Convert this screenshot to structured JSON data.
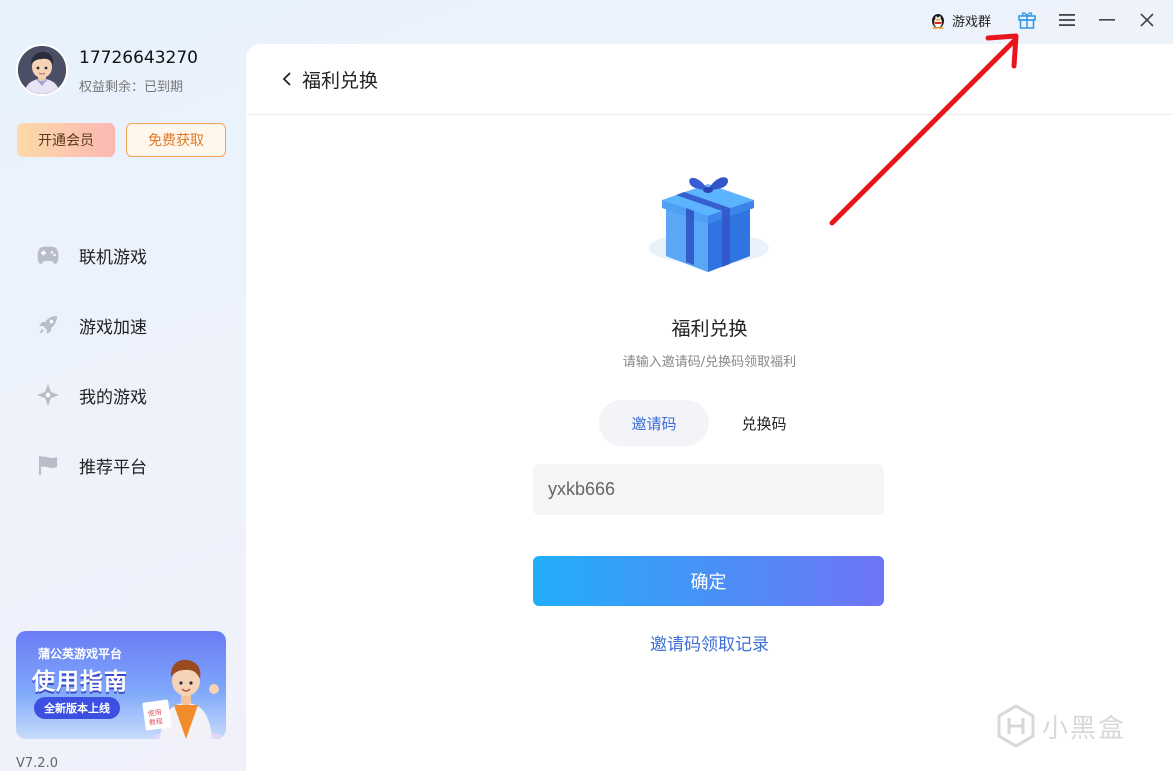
{
  "topbar": {
    "qq_group_label": "游戏群",
    "qq_icon": "qq-penguin-icon",
    "gift_icon": "gift-icon",
    "menu_icon": "menu-icon",
    "minimize_icon": "minimize-icon",
    "close_icon": "close-icon"
  },
  "user": {
    "phone": "17726643270",
    "rights_label": "权益剩余：",
    "rights_value": "已到期"
  },
  "sidebar": {
    "vip_button": "开通会员",
    "free_button": "免费获取",
    "items": [
      {
        "label": "联机游戏",
        "icon": "gamepad-icon"
      },
      {
        "label": "游戏加速",
        "icon": "rocket-icon"
      },
      {
        "label": "我的游戏",
        "icon": "star-diamond-icon"
      },
      {
        "label": "推荐平台",
        "icon": "flag-icon"
      }
    ],
    "banner": {
      "platform": "蒲公英游戏平台",
      "title": "使用指南",
      "pill": "全新版本上线"
    },
    "version": "V7.2.0"
  },
  "main": {
    "header_title": "福利兑换",
    "card_title": "福利兑换",
    "card_subtitle": "请输入邀请码/兑换码领取福利",
    "tabs": [
      {
        "label": "邀请码",
        "active": true
      },
      {
        "label": "兑换码",
        "active": false
      }
    ],
    "code_value": "yxkb666",
    "confirm_label": "确定",
    "record_link": "邀请码领取记录"
  },
  "watermark": {
    "text": "小黑盒"
  },
  "colors": {
    "accent_blue": "#3c6bd8",
    "confirm_gradient_start": "#22aef8",
    "confirm_gradient_end": "#6f74f5",
    "vip_gradient_start": "#fdd9a8",
    "vip_gradient_end": "#fbb8b3",
    "free_border": "#f0a35b",
    "annotation_arrow": "#e8161c"
  }
}
